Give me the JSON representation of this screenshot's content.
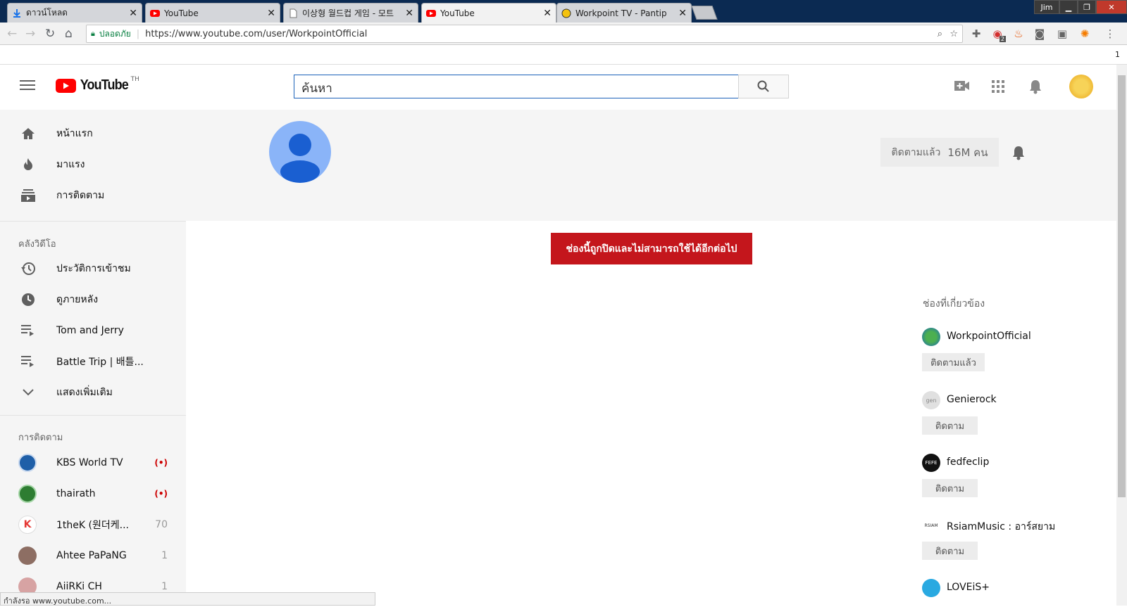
{
  "browser": {
    "tabs": [
      {
        "title": "ดาวน์โหลด",
        "icon": "download-icon"
      },
      {
        "title": "YouTube",
        "icon": "youtube-icon"
      },
      {
        "title": "이상형 월드컵 게임 - 모트",
        "icon": "page-icon"
      },
      {
        "title": "YouTube",
        "icon": "youtube-icon"
      },
      {
        "title": "Workpoint TV - Pantip",
        "icon": "pantip-icon"
      }
    ],
    "window_user": "Jim",
    "security_label": "ปลอดภัย",
    "url": "https://www.youtube.com/user/WorkpointOfficial",
    "extension_badge": "2",
    "bookmark_count": "1",
    "status_text": "กำลังรอ www.youtube.com..."
  },
  "header": {
    "logo_text": "YouTube",
    "region": "TH",
    "search_placeholder": "ค้นหา"
  },
  "sidebar": {
    "main": [
      {
        "label": "หน้าแรก",
        "icon": "home-icon"
      },
      {
        "label": "มาแรง",
        "icon": "flame-icon"
      },
      {
        "label": "การติดตาม",
        "icon": "subscriptions-icon"
      }
    ],
    "library_heading": "คลังวิดีโอ",
    "library": [
      {
        "label": "ประวัติการเข้าชม",
        "icon": "history-icon"
      },
      {
        "label": "ดูภายหลัง",
        "icon": "clock-icon"
      },
      {
        "label": "Tom and Jerry",
        "icon": "playlist-icon"
      },
      {
        "label": "Battle Trip | 배틀...",
        "icon": "playlist-icon"
      },
      {
        "label": "แสดงเพิ่มเติม",
        "icon": "chevron-down-icon"
      }
    ],
    "subs_heading": "การติดตาม",
    "subscriptions": [
      {
        "label": "KBS World TV",
        "badge": "(•)",
        "color": "#1f5fa8"
      },
      {
        "label": "thairath",
        "badge": "(•)",
        "color": "#2e7d32"
      },
      {
        "label": "1theK (원더케...",
        "badge": "70",
        "color": "#e53935"
      },
      {
        "label": "Ahtee PaPaNG",
        "badge": "1",
        "color": "#8d6e63"
      },
      {
        "label": "AiiRKi CH",
        "badge": "1",
        "color": "#d7a3a3"
      }
    ]
  },
  "channel": {
    "subscribe_label": "ติดตามแล้ว",
    "subscriber_count": "16M คน",
    "terminated_message": "ช่องนี้ถูกปิดและไม่สามารถใช้ได้อีกต่อไป"
  },
  "related": {
    "heading": "ช่องที่เกี่ยวข้อง",
    "channels": [
      {
        "name": "WorkpointOfficial",
        "button": "ติดตามแล้ว",
        "color": "#4caf50"
      },
      {
        "name": "Genierock",
        "button": "ติดตาม",
        "color": "#e0e0e0"
      },
      {
        "name": "fedfeclip",
        "button": "ติดตาม",
        "color": "#111111"
      },
      {
        "name": "RsiamMusic : อาร์สยาม",
        "button": "ติดตาม",
        "color": "#ffffff"
      },
      {
        "name": "LOVEiS+",
        "button": "ติดตาม",
        "color": "#29a9e1"
      }
    ]
  },
  "colors": {
    "youtube_red": "#ff0000",
    "alert_red": "#c4161c",
    "search_blue": "#1c62b9"
  }
}
